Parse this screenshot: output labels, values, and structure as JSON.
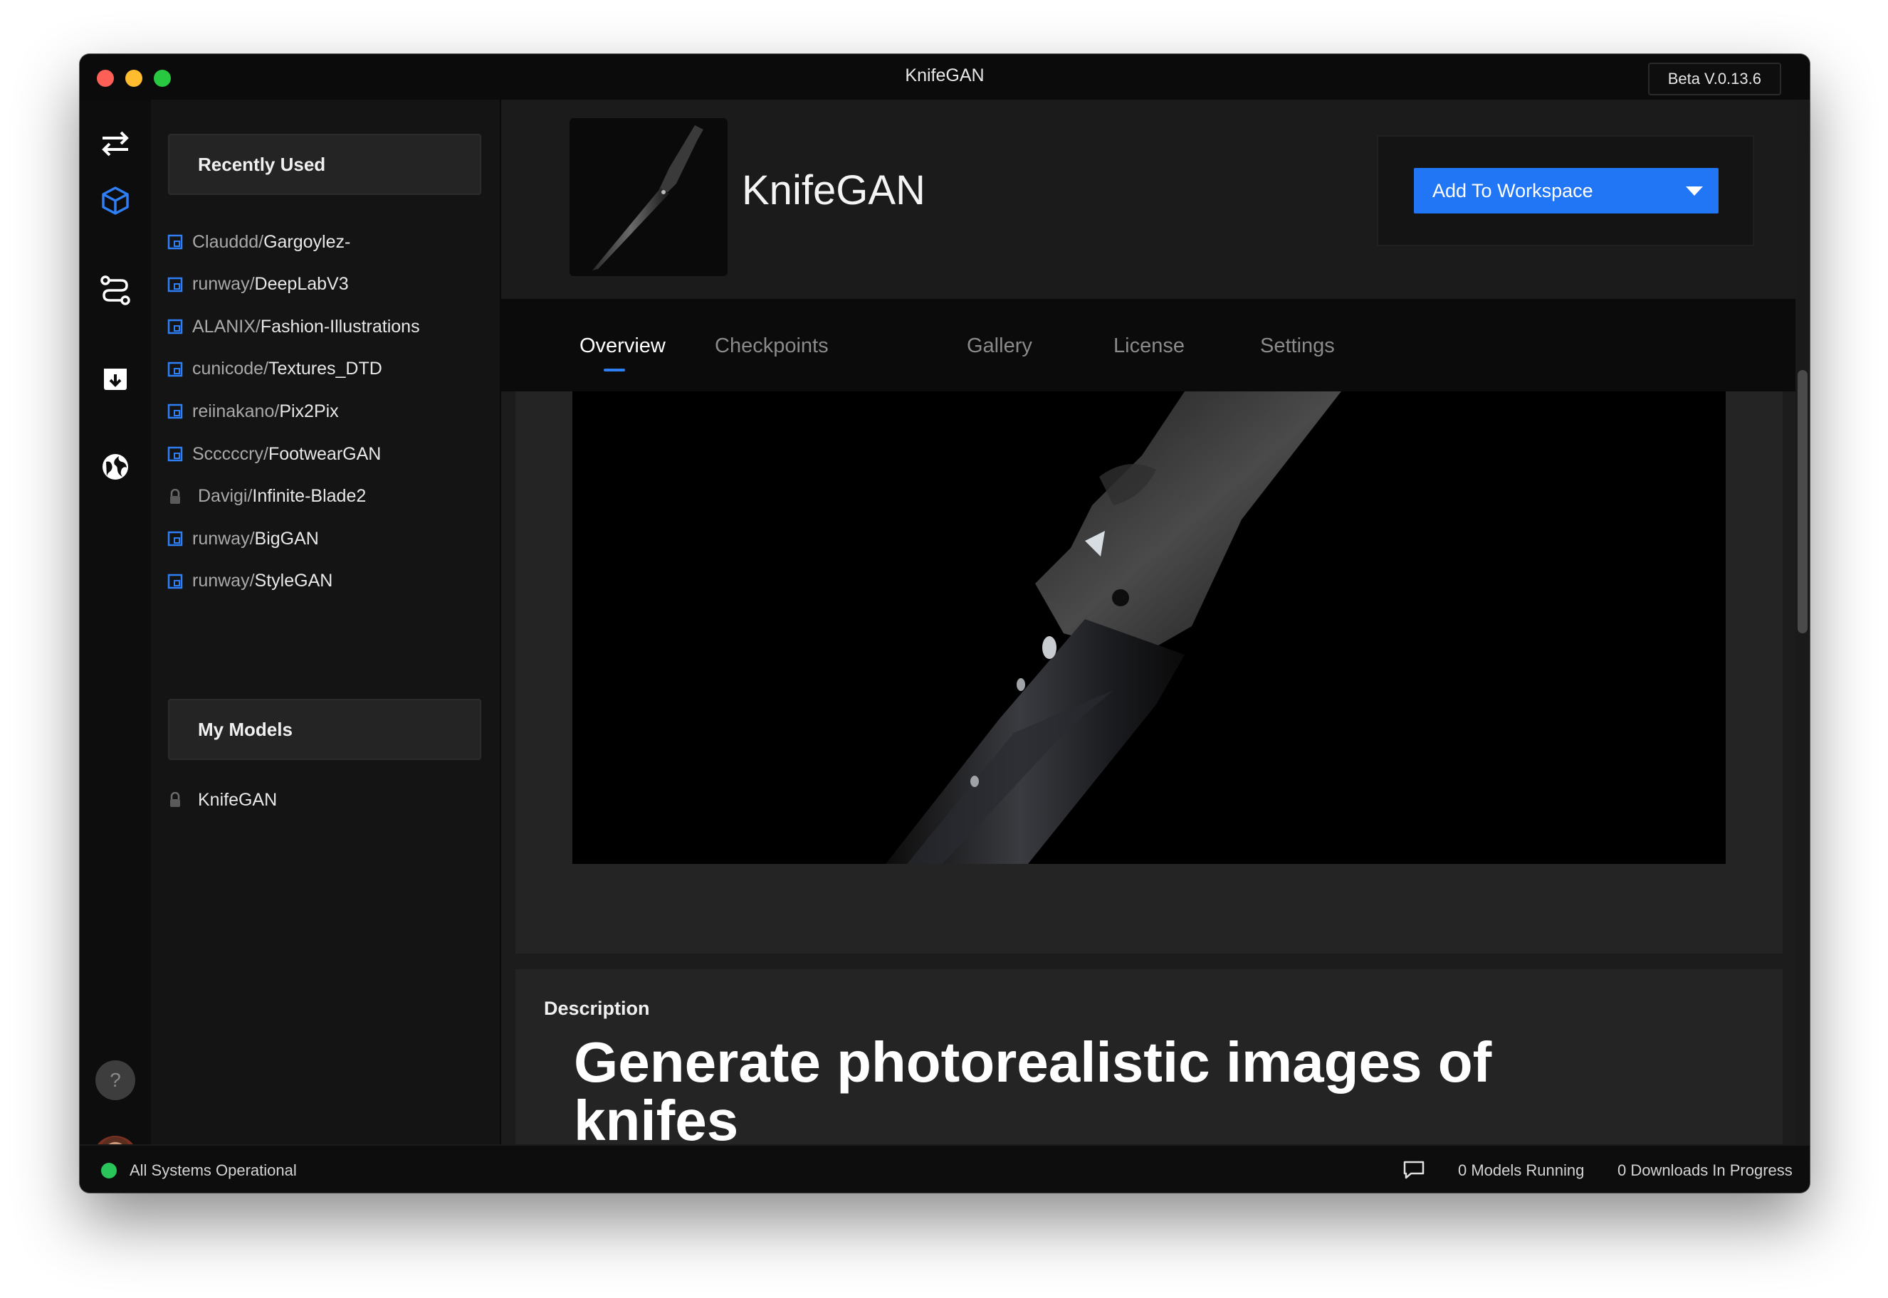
{
  "window": {
    "title": "KnifeGAN",
    "version": "Beta V.0.13.6"
  },
  "rail": {
    "icons": [
      "swap-arrows-icon",
      "cube-icon",
      "workflow-icon",
      "download-box-icon",
      "globe-icon",
      "help-icon",
      "avatar"
    ],
    "help_glyph": "?",
    "accent": "#2e7ff5"
  },
  "sidebar": {
    "recent_title": "Recently Used",
    "recent": [
      {
        "owner": "Clauddd/",
        "name": "Gargoylez-",
        "locked": false
      },
      {
        "owner": "runway/",
        "name": "DeepLabV3",
        "locked": false
      },
      {
        "owner": "ALANIX/",
        "name": "Fashion-Illustrations",
        "locked": false
      },
      {
        "owner": "cunicode/",
        "name": "Textures_DTD",
        "locked": false
      },
      {
        "owner": "reiinakano/",
        "name": "Pix2Pix",
        "locked": false
      },
      {
        "owner": "Scccccry/",
        "name": "FootwearGAN",
        "locked": false
      },
      {
        "owner": "Davigi/",
        "name": "Infinite-Blade2",
        "locked": true
      },
      {
        "owner": "runway/",
        "name": "BigGAN",
        "locked": false
      },
      {
        "owner": "runway/",
        "name": "StyleGAN",
        "locked": false
      }
    ],
    "my_models_title": "My Models",
    "my_models": [
      {
        "owner": "",
        "name": "KnifeGAN",
        "locked": true
      }
    ]
  },
  "model": {
    "title": "KnifeGAN",
    "add_button": "Add To Workspace"
  },
  "tabs": [
    {
      "label": "Overview",
      "active": true
    },
    {
      "label": "Checkpoints",
      "active": false
    },
    {
      "label": "Gallery",
      "active": false
    },
    {
      "label": "License",
      "active": false
    },
    {
      "label": "Settings",
      "active": false
    }
  ],
  "description": {
    "label": "Description",
    "heading_line1": "Generate photorealistic images of",
    "heading_line2": "knifes"
  },
  "status": {
    "system": "All Systems Operational",
    "system_color": "#29c55a",
    "models_running": "0 Models Running",
    "downloads": "0 Downloads In Progress"
  }
}
